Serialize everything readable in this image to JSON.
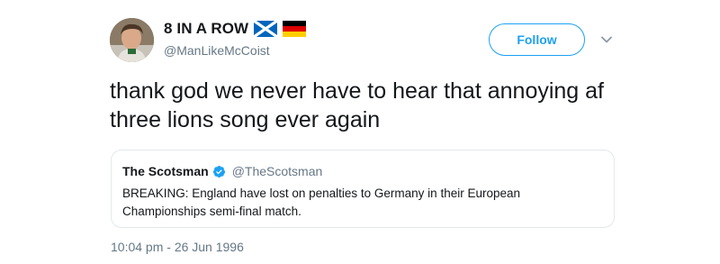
{
  "author": {
    "display_name": "8 IN A ROW",
    "handle": "@ManLikeMcCoist",
    "flags": [
      "scotland-flag-icon",
      "germany-flag-icon"
    ]
  },
  "actions": {
    "follow_label": "Follow",
    "menu_icon": "chevron-down-icon"
  },
  "tweet": {
    "text": "thank god we never have to hear that annoying af three lions song ever again",
    "timestamp": "10:04 pm - 26 Jun 1996"
  },
  "quoted_tweet": {
    "author_name": "The Scotsman",
    "verified_icon": "verified-badge-icon",
    "handle": "@TheScotsman",
    "text": "BREAKING: England have lost on penalties to Germany in their European Championships semi-final match."
  },
  "colors": {
    "accent": "#1da1f2",
    "text": "#14171a",
    "muted": "#657786",
    "border": "#e1e8ed"
  }
}
